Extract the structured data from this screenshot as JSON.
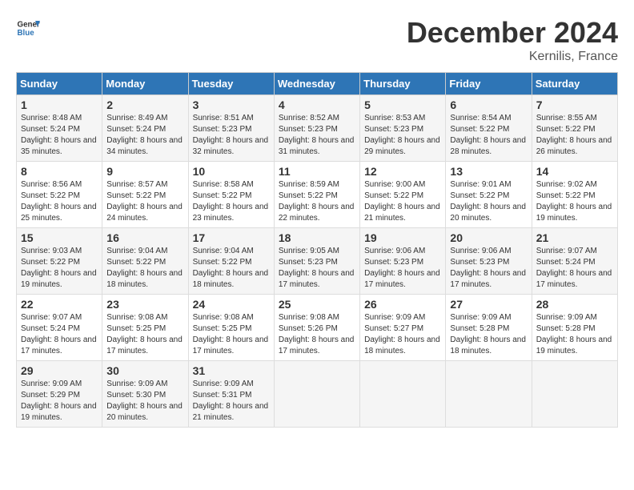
{
  "header": {
    "logo_line1": "General",
    "logo_line2": "Blue",
    "month_title": "December 2024",
    "subtitle": "Kernilis, France"
  },
  "days_of_week": [
    "Sunday",
    "Monday",
    "Tuesday",
    "Wednesday",
    "Thursday",
    "Friday",
    "Saturday"
  ],
  "weeks": [
    [
      {
        "day": "1",
        "sunrise": "Sunrise: 8:48 AM",
        "sunset": "Sunset: 5:24 PM",
        "daylight": "Daylight: 8 hours and 35 minutes."
      },
      {
        "day": "2",
        "sunrise": "Sunrise: 8:49 AM",
        "sunset": "Sunset: 5:24 PM",
        "daylight": "Daylight: 8 hours and 34 minutes."
      },
      {
        "day": "3",
        "sunrise": "Sunrise: 8:51 AM",
        "sunset": "Sunset: 5:23 PM",
        "daylight": "Daylight: 8 hours and 32 minutes."
      },
      {
        "day": "4",
        "sunrise": "Sunrise: 8:52 AM",
        "sunset": "Sunset: 5:23 PM",
        "daylight": "Daylight: 8 hours and 31 minutes."
      },
      {
        "day": "5",
        "sunrise": "Sunrise: 8:53 AM",
        "sunset": "Sunset: 5:23 PM",
        "daylight": "Daylight: 8 hours and 29 minutes."
      },
      {
        "day": "6",
        "sunrise": "Sunrise: 8:54 AM",
        "sunset": "Sunset: 5:22 PM",
        "daylight": "Daylight: 8 hours and 28 minutes."
      },
      {
        "day": "7",
        "sunrise": "Sunrise: 8:55 AM",
        "sunset": "Sunset: 5:22 PM",
        "daylight": "Daylight: 8 hours and 26 minutes."
      }
    ],
    [
      {
        "day": "8",
        "sunrise": "Sunrise: 8:56 AM",
        "sunset": "Sunset: 5:22 PM",
        "daylight": "Daylight: 8 hours and 25 minutes."
      },
      {
        "day": "9",
        "sunrise": "Sunrise: 8:57 AM",
        "sunset": "Sunset: 5:22 PM",
        "daylight": "Daylight: 8 hours and 24 minutes."
      },
      {
        "day": "10",
        "sunrise": "Sunrise: 8:58 AM",
        "sunset": "Sunset: 5:22 PM",
        "daylight": "Daylight: 8 hours and 23 minutes."
      },
      {
        "day": "11",
        "sunrise": "Sunrise: 8:59 AM",
        "sunset": "Sunset: 5:22 PM",
        "daylight": "Daylight: 8 hours and 22 minutes."
      },
      {
        "day": "12",
        "sunrise": "Sunrise: 9:00 AM",
        "sunset": "Sunset: 5:22 PM",
        "daylight": "Daylight: 8 hours and 21 minutes."
      },
      {
        "day": "13",
        "sunrise": "Sunrise: 9:01 AM",
        "sunset": "Sunset: 5:22 PM",
        "daylight": "Daylight: 8 hours and 20 minutes."
      },
      {
        "day": "14",
        "sunrise": "Sunrise: 9:02 AM",
        "sunset": "Sunset: 5:22 PM",
        "daylight": "Daylight: 8 hours and 19 minutes."
      }
    ],
    [
      {
        "day": "15",
        "sunrise": "Sunrise: 9:03 AM",
        "sunset": "Sunset: 5:22 PM",
        "daylight": "Daylight: 8 hours and 19 minutes."
      },
      {
        "day": "16",
        "sunrise": "Sunrise: 9:04 AM",
        "sunset": "Sunset: 5:22 PM",
        "daylight": "Daylight: 8 hours and 18 minutes."
      },
      {
        "day": "17",
        "sunrise": "Sunrise: 9:04 AM",
        "sunset": "Sunset: 5:22 PM",
        "daylight": "Daylight: 8 hours and 18 minutes."
      },
      {
        "day": "18",
        "sunrise": "Sunrise: 9:05 AM",
        "sunset": "Sunset: 5:23 PM",
        "daylight": "Daylight: 8 hours and 17 minutes."
      },
      {
        "day": "19",
        "sunrise": "Sunrise: 9:06 AM",
        "sunset": "Sunset: 5:23 PM",
        "daylight": "Daylight: 8 hours and 17 minutes."
      },
      {
        "day": "20",
        "sunrise": "Sunrise: 9:06 AM",
        "sunset": "Sunset: 5:23 PM",
        "daylight": "Daylight: 8 hours and 17 minutes."
      },
      {
        "day": "21",
        "sunrise": "Sunrise: 9:07 AM",
        "sunset": "Sunset: 5:24 PM",
        "daylight": "Daylight: 8 hours and 17 minutes."
      }
    ],
    [
      {
        "day": "22",
        "sunrise": "Sunrise: 9:07 AM",
        "sunset": "Sunset: 5:24 PM",
        "daylight": "Daylight: 8 hours and 17 minutes."
      },
      {
        "day": "23",
        "sunrise": "Sunrise: 9:08 AM",
        "sunset": "Sunset: 5:25 PM",
        "daylight": "Daylight: 8 hours and 17 minutes."
      },
      {
        "day": "24",
        "sunrise": "Sunrise: 9:08 AM",
        "sunset": "Sunset: 5:25 PM",
        "daylight": "Daylight: 8 hours and 17 minutes."
      },
      {
        "day": "25",
        "sunrise": "Sunrise: 9:08 AM",
        "sunset": "Sunset: 5:26 PM",
        "daylight": "Daylight: 8 hours and 17 minutes."
      },
      {
        "day": "26",
        "sunrise": "Sunrise: 9:09 AM",
        "sunset": "Sunset: 5:27 PM",
        "daylight": "Daylight: 8 hours and 18 minutes."
      },
      {
        "day": "27",
        "sunrise": "Sunrise: 9:09 AM",
        "sunset": "Sunset: 5:28 PM",
        "daylight": "Daylight: 8 hours and 18 minutes."
      },
      {
        "day": "28",
        "sunrise": "Sunrise: 9:09 AM",
        "sunset": "Sunset: 5:28 PM",
        "daylight": "Daylight: 8 hours and 19 minutes."
      }
    ],
    [
      {
        "day": "29",
        "sunrise": "Sunrise: 9:09 AM",
        "sunset": "Sunset: 5:29 PM",
        "daylight": "Daylight: 8 hours and 19 minutes."
      },
      {
        "day": "30",
        "sunrise": "Sunrise: 9:09 AM",
        "sunset": "Sunset: 5:30 PM",
        "daylight": "Daylight: 8 hours and 20 minutes."
      },
      {
        "day": "31",
        "sunrise": "Sunrise: 9:09 AM",
        "sunset": "Sunset: 5:31 PM",
        "daylight": "Daylight: 8 hours and 21 minutes."
      },
      null,
      null,
      null,
      null
    ]
  ]
}
